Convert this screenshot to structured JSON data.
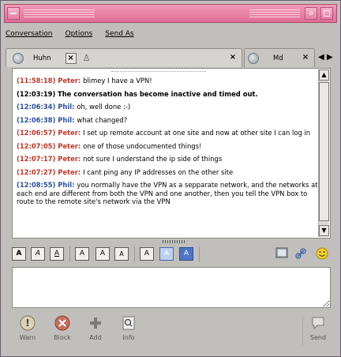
{
  "menu": {
    "items": [
      "Conversation",
      "Options",
      "Send As"
    ]
  },
  "tabs": [
    {
      "label": "Huhn",
      "icon": "person-icon"
    },
    {
      "label": "Md",
      "icon": "person-icon"
    }
  ],
  "conversation": [
    {
      "ts": "(11:58:18)",
      "nick": "Peter:",
      "who": "peter",
      "text": "blimey I have a VPN!"
    },
    {
      "ts": "(12:03:19)",
      "nick": "",
      "who": "sys",
      "text": "The conversation has become inactive and timed out."
    },
    {
      "ts": "(12:06:34)",
      "nick": "Phil:",
      "who": "phil",
      "text": "oh, well done :-)"
    },
    {
      "ts": "(12:06:38)",
      "nick": "Phil:",
      "who": "phil",
      "text": "what changed?"
    },
    {
      "ts": "(12:06:57)",
      "nick": "Peter:",
      "who": "peter",
      "text": "I set up remote account at one site and now at other site I can log in"
    },
    {
      "ts": "(12:07:05)",
      "nick": "Peter:",
      "who": "peter",
      "text": "one of those undocumented things!"
    },
    {
      "ts": "(12:07:17)",
      "nick": "Peter:",
      "who": "peter",
      "text": "not sure I understand the ip side of things"
    },
    {
      "ts": "(12:07:27)",
      "nick": "Peter:",
      "who": "peter",
      "text": "I cant ping any IP addresses on the other site"
    },
    {
      "ts": "(12:08:55)",
      "nick": "Phil:",
      "who": "phil",
      "text": "you normally have the VPN as a sepparate network, and the networks at each end are different from both the VPN and one another, then you tell the VPN box to route to the remote site's network via the VPN"
    }
  ],
  "format_toolbar": {
    "bold": "A",
    "italic": "A",
    "underline": "A",
    "grow": "A",
    "normal": "A",
    "shrink": "A",
    "font": "A",
    "fg": "A",
    "bg": "A"
  },
  "bottom_toolbar": {
    "warn": "Warn",
    "block": "Block",
    "add": "Add",
    "info": "Info",
    "send": "Send"
  },
  "colors": {
    "titlebar": "#e06c95",
    "peter": "#c4362a",
    "phil": "#2d4fa3"
  }
}
